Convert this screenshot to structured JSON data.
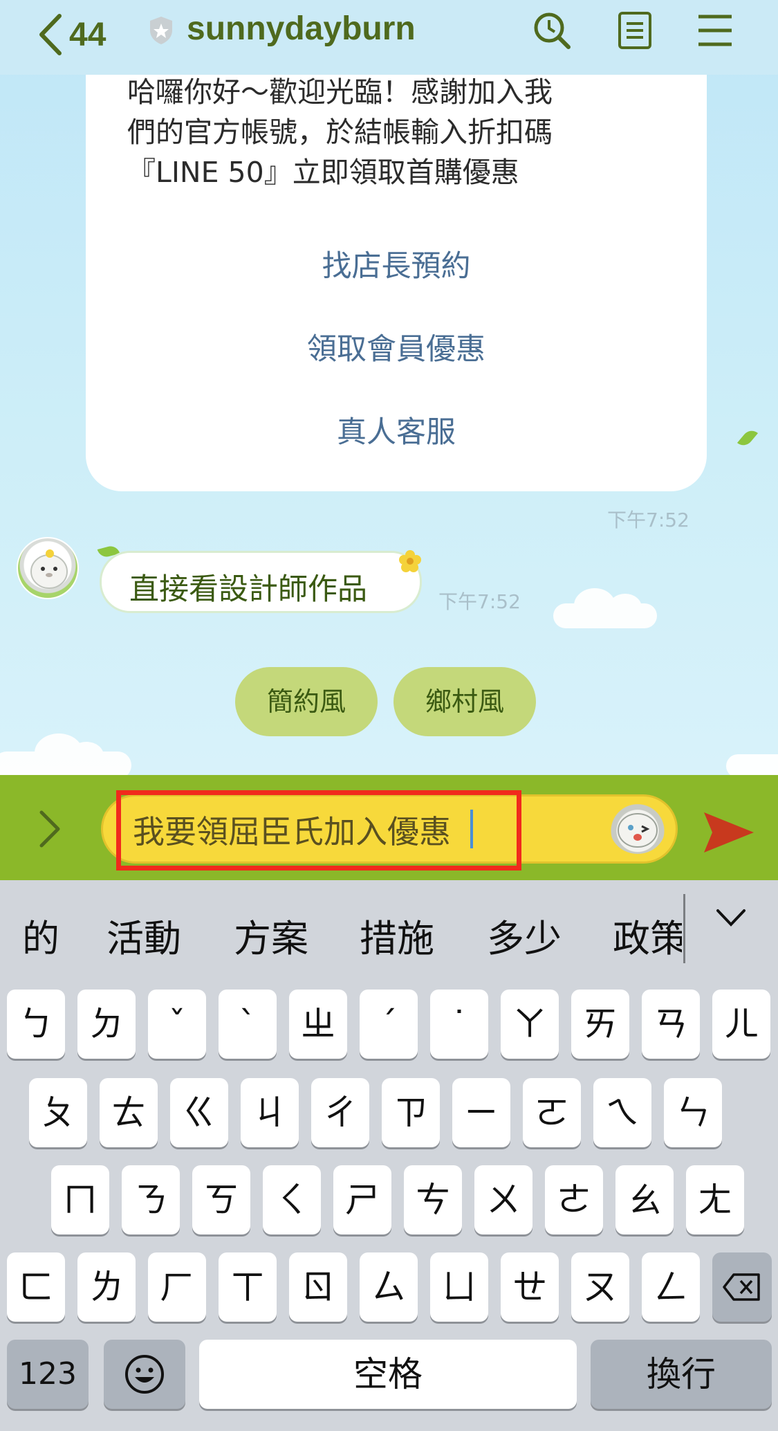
{
  "header": {
    "back_count": "44",
    "title": "sunnydayburn",
    "icons": [
      "search-icon",
      "notes-icon",
      "menu-icon"
    ]
  },
  "chat": {
    "bot_message": "哈囉你好～歡迎光臨！感謝加入我\n們的官方帳號，於結帳輸入折扣碼\n『LINE 50』立即領取首購優惠",
    "menu_links": [
      "找店長預約",
      "領取會員優惠",
      "真人客服"
    ],
    "time_1": "下午7:52",
    "user_message": "直接看設計師作品",
    "time_2": "下午7:52",
    "quick_replies": [
      "簡約風",
      "鄉村風"
    ]
  },
  "input": {
    "value": "我要領屈臣氏加入優惠"
  },
  "keyboard": {
    "suggestions": [
      "的",
      "活動",
      "方案",
      "措施",
      "多少",
      "政策"
    ],
    "row1": [
      "ㄅ",
      "ㄉ",
      "ˇ",
      "ˋ",
      "ㄓ",
      "ˊ",
      "˙",
      "ㄚ",
      "ㄞ",
      "ㄢ",
      "ㄦ"
    ],
    "row2": [
      "ㄆ",
      "ㄊ",
      "ㄍ",
      "ㄐ",
      "ㄔ",
      "ㄗ",
      "ㄧ",
      "ㄛ",
      "ㄟ",
      "ㄣ"
    ],
    "row3": [
      "ㄇ",
      "ㄋ",
      "ㄎ",
      "ㄑ",
      "ㄕ",
      "ㄘ",
      "ㄨ",
      "ㄜ",
      "ㄠ",
      "ㄤ"
    ],
    "row4": [
      "ㄈ",
      "ㄌ",
      "ㄏ",
      "ㄒ",
      "ㄖ",
      "ㄙ",
      "ㄩ",
      "ㄝ",
      "ㄡ",
      "ㄥ"
    ],
    "numbers_label": "123",
    "space_label": "空格",
    "return_label": "換行"
  },
  "colors": {
    "header_text": "#4f6a1e",
    "input_bar": "#8bb829",
    "input_pill": "#f7d93b",
    "highlight_box": "#f12a1c",
    "send_arrow": "#c8391e",
    "link_text": "#4a6e94"
  }
}
